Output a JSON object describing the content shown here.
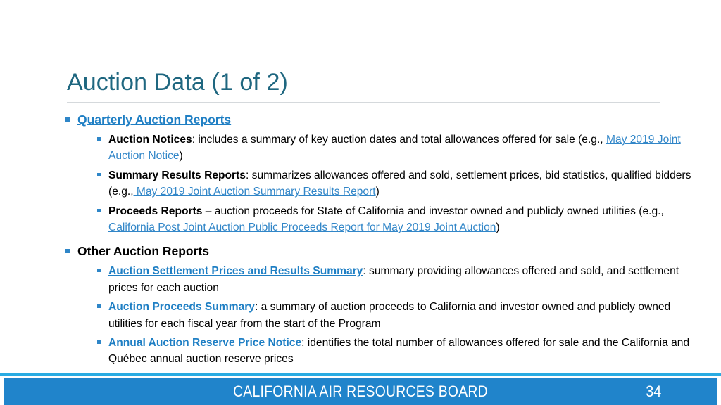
{
  "slide": {
    "title": "Auction Data (1 of 2)",
    "page_number": "34",
    "footer_org": "CALIFORNIA AIR RESOURCES BOARD",
    "colors": {
      "title": "#1F6780",
      "link": "#1F7FC4",
      "link_inline": "#3186C8",
      "bullet": "#2E86C8",
      "footer_bar": "#2084CB",
      "footer_strip": "#29ABE2",
      "rule": "#D5D9DC"
    }
  },
  "sections": [
    {
      "heading": "Quarterly Auction Reports",
      "heading_is_link": true,
      "items": [
        {
          "term": "Auction Notices",
          "term_is_link": false,
          "body_1": ": includes a summary of key auction dates and total allowances offered for sale (e.g., ",
          "link": "May 2019 Joint Auction Notice",
          "body_2": ")"
        },
        {
          "term": "Summary Results Reports",
          "term_is_link": false,
          "body_1": ": summarizes allowances offered and sold, settlement prices, bid statistics, qualified bidders (e.g.,",
          "link": " May 2019 Joint Auction Summary Results Report",
          "body_2": ")"
        },
        {
          "term": "Proceeds Reports",
          "term_is_link": false,
          "body_1": " – auction proceeds for State of California and investor owned and publicly owned utilities (e.g., ",
          "link": "California Post Joint Auction Public Proceeds Report for May 2019 Joint Auction",
          "body_2": ")"
        }
      ]
    },
    {
      "heading": "Other Auction Reports",
      "heading_is_link": false,
      "items": [
        {
          "term": "Auction Settlement Prices and Results Summary",
          "term_is_link": true,
          "body_1": ": summary providing allowances offered and sold, and settlement prices for each auction",
          "link": "",
          "body_2": ""
        },
        {
          "term": "Auction Proceeds Summary",
          "term_is_link": true,
          "body_1": ": a summary of auction proceeds to California and investor owned and publicly owned utilities for each fiscal year from the start of the Program",
          "link": "",
          "body_2": ""
        },
        {
          "term": "Annual Auction Reserve Price Notice",
          "term_is_link": true,
          "body_1": ": identifies the total number of allowances offered for sale and the California and Québec annual auction reserve prices",
          "link": "",
          "body_2": ""
        }
      ]
    }
  ]
}
